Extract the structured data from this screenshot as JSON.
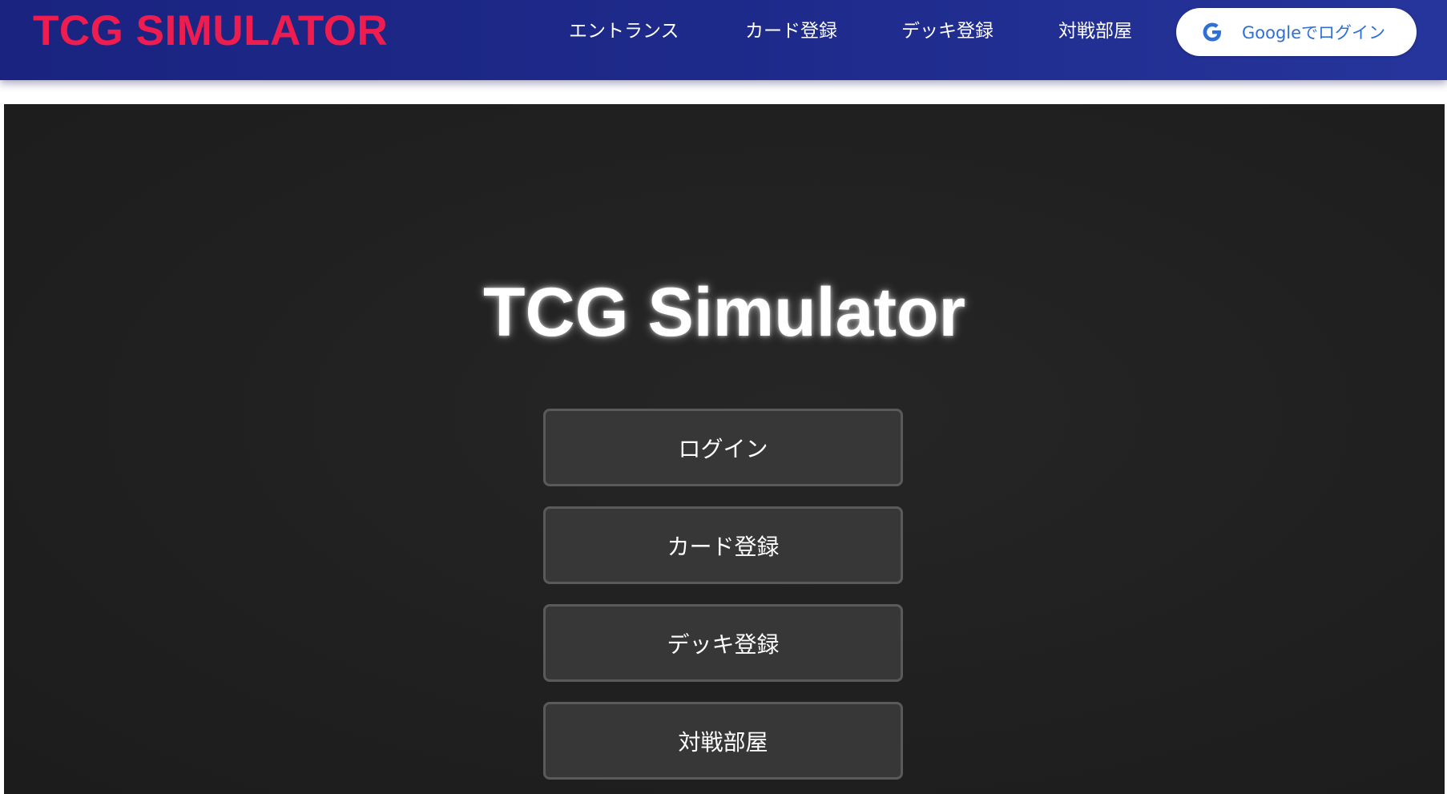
{
  "header": {
    "brand": "TCG SIMULATOR",
    "nav": [
      {
        "label": "エントランス"
      },
      {
        "label": "カード登録"
      },
      {
        "label": "デッキ登録"
      },
      {
        "label": "対戦部屋"
      }
    ],
    "google_login": {
      "label": "Googleでログイン",
      "icon": "google-g-icon"
    }
  },
  "hero": {
    "title": "TCG Simulator",
    "buttons": [
      {
        "label": "ログイン"
      },
      {
        "label": "カード登録"
      },
      {
        "label": "デッキ登録"
      },
      {
        "label": "対戦部屋"
      }
    ]
  },
  "colors": {
    "navbar": "#1e2a8a",
    "brand": "#ef1d4f",
    "hero_background": "#222222",
    "button_background": "#373737",
    "google_text": "#2f6fd6"
  }
}
